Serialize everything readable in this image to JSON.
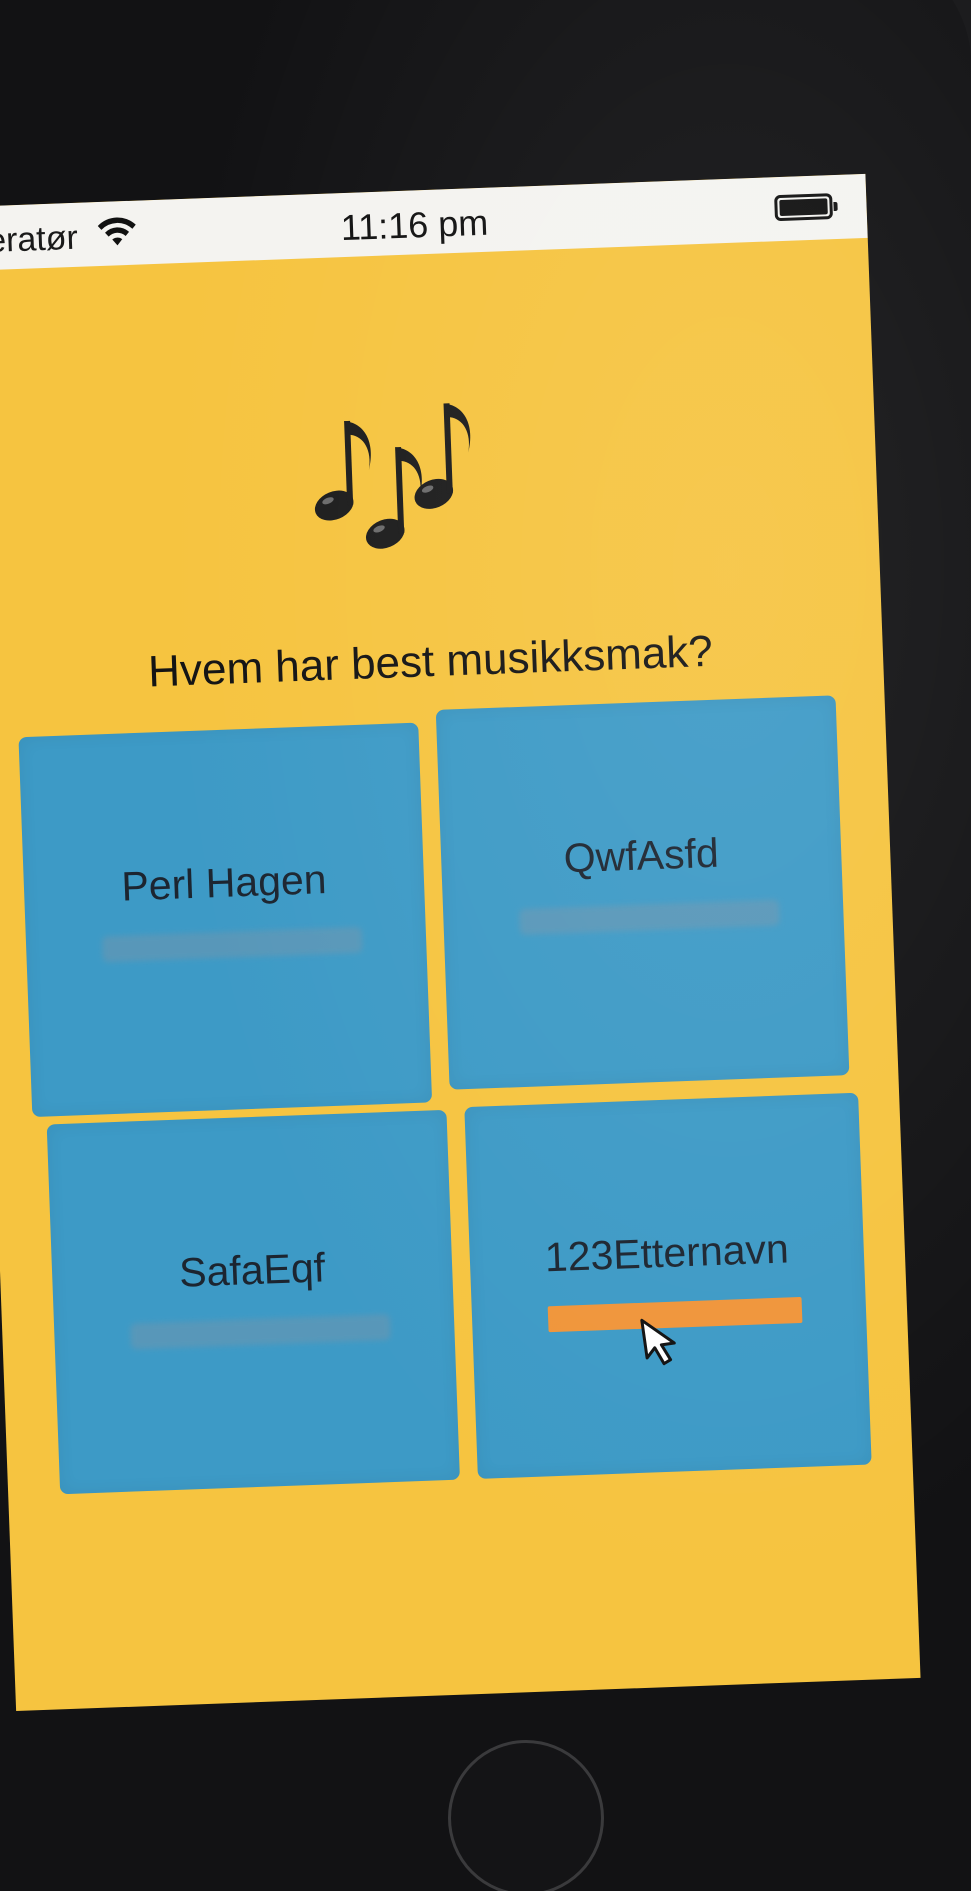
{
  "status_bar": {
    "carrier": "peratør",
    "time": "11:16 pm",
    "wifi_icon": "wifi-icon",
    "battery_icon": "battery-icon"
  },
  "app": {
    "emoji": "multiple-musical-notes",
    "question": "Hvem har best musikksmak?",
    "colors": {
      "background": "#f6c440",
      "tile": "#3d9ac6",
      "vote_bar": "#f0953a"
    },
    "options": [
      {
        "name": "Perl Hagen",
        "vote_fraction": 0
      },
      {
        "name": "QwfAsfd",
        "vote_fraction": 0
      },
      {
        "name": "SafaEqf",
        "vote_fraction": 0
      },
      {
        "name": "123Etternavn",
        "vote_fraction": 1
      }
    ]
  },
  "device": {
    "home_button": "home-button"
  }
}
